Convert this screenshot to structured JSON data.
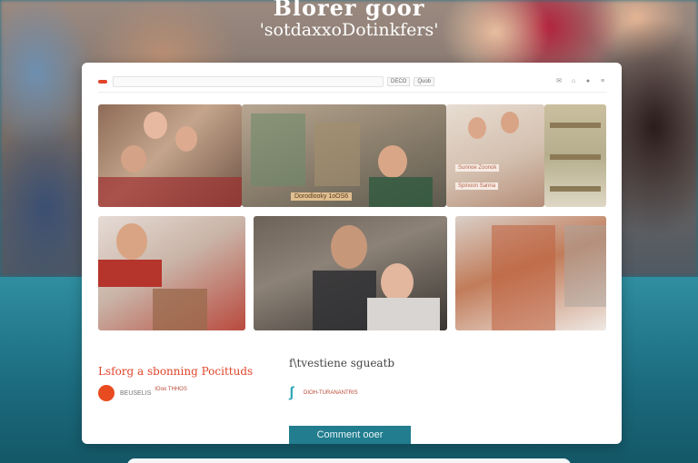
{
  "hero": {
    "title": "Blorer goor",
    "subtitle": "'sotdaxxoDotinkfers'"
  },
  "topbar": {
    "search_placeholder": "",
    "button1": "DECO",
    "button2": "Quob",
    "icons": [
      "logo-icon",
      "chat-icon",
      "cart-icon",
      "user-icon",
      "menu-icon"
    ]
  },
  "tiles": {
    "caption": "Dorodlooky 1oOS6",
    "tag1": "Sunnoe Zoonok",
    "tag2": "Spinoon Sanna"
  },
  "left_panel": {
    "title": "Lsforg a sbonning Pocittuds",
    "meta1": "BEUSELIS",
    "meta2": "IOoo THHOS"
  },
  "right_panel": {
    "title": "f\\tvestiene sgueatb",
    "meta1": "DIOH-TURANANTRIS"
  },
  "cta": {
    "label": "Comment ooer"
  },
  "colors": {
    "accent": "#e0452b",
    "teal": "#227d8f",
    "band": "#2f8ea0"
  }
}
